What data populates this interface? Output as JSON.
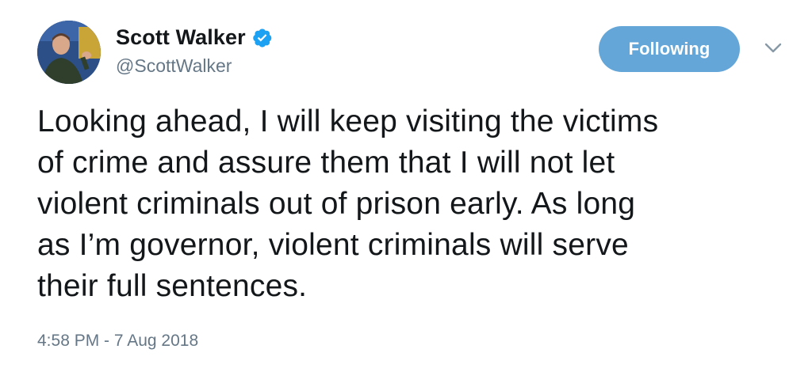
{
  "author": {
    "display_name": "Scott Walker",
    "handle": "@ScottWalker",
    "verified": true,
    "avatar_icon": "profile-photo"
  },
  "follow_button": {
    "label": "Following"
  },
  "menu": {
    "icon": "chevron-down-icon"
  },
  "tweet": {
    "text_lines": [
      "Looking ahead, I will keep visiting the victims",
      "of crime and assure them that I will not let",
      "violent criminals out of prison early. As long",
      "as I’m governor, violent criminals will serve",
      "their full sentences."
    ],
    "timestamp": "4:58 PM - 7 Aug 2018"
  },
  "colors": {
    "follow_button_bg": "#64a6d7",
    "verified_badge": "#1da1f2",
    "secondary_text": "#657786",
    "primary_text": "#14171a"
  }
}
